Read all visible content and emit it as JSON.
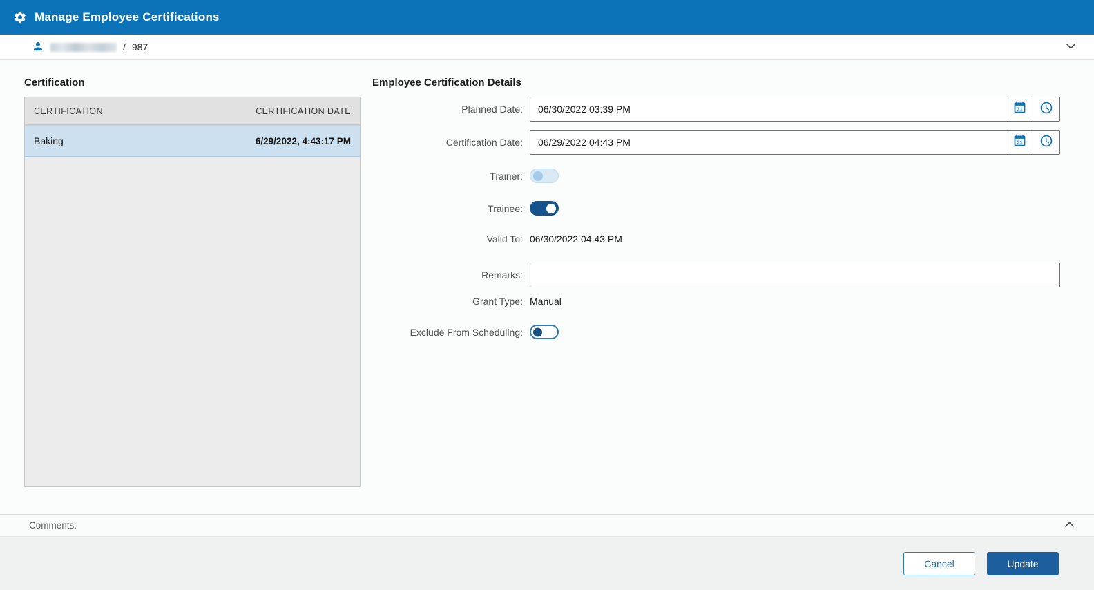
{
  "colors": {
    "header_blue": "#0d73b9",
    "accent_blue": "#0d73b9",
    "toggle_on_blue": "#15538c",
    "selected_row_blue": "#cce0f0",
    "update_button_blue": "#1d5f9e"
  },
  "header": {
    "title": "Manage Employee Certifications"
  },
  "employee_bar": {
    "separator": "/",
    "employee_number": "987"
  },
  "certification_panel": {
    "title": "Certification",
    "columns": [
      "CERTIFICATION",
      "CERTIFICATION DATE"
    ],
    "rows": [
      {
        "certification": "Baking",
        "certification_date": "6/29/2022, 4:43:17 PM",
        "selected": true
      }
    ]
  },
  "details_panel": {
    "title": "Employee Certification Details",
    "planned_date": {
      "label": "Planned Date:",
      "value": "06/30/2022 03:39 PM"
    },
    "certification_date": {
      "label": "Certification Date:",
      "value": "06/29/2022 04:43 PM"
    },
    "trainer": {
      "label": "Trainer:",
      "state": "off-disabled"
    },
    "trainee": {
      "label": "Trainee:",
      "state": "on"
    },
    "valid_to": {
      "label": "Valid To:",
      "value": "06/30/2022 04:43 PM"
    },
    "remarks": {
      "label": "Remarks:",
      "value": ""
    },
    "grant_type": {
      "label": "Grant Type:",
      "value": "Manual"
    },
    "exclude_from_scheduling": {
      "label": "Exclude From Scheduling:",
      "state": "off"
    }
  },
  "comments": {
    "label": "Comments:"
  },
  "footer": {
    "cancel_label": "Cancel",
    "update_label": "Update"
  }
}
